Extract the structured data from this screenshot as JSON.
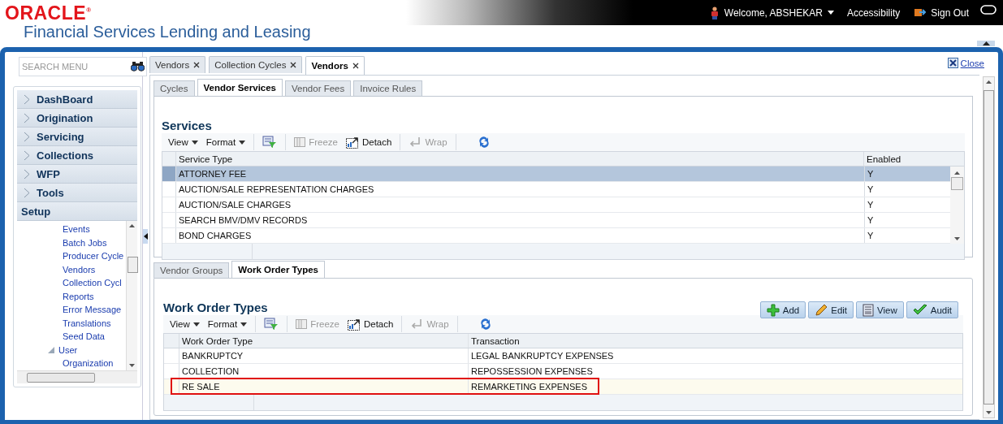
{
  "header": {
    "logo": "ORACLE$^{®}$",
    "product": "Financial Services Lending and Leasing",
    "welcome": "Welcome, ABSHEKAR",
    "accessibility": "Accessibility",
    "sign_out": "Sign Out"
  },
  "search": {
    "placeholder": "SEARCH MENU"
  },
  "nav": [
    {
      "label": "DashBoard",
      "expanded": false
    },
    {
      "label": "Origination",
      "expanded": false
    },
    {
      "label": "Servicing",
      "expanded": false
    },
    {
      "label": "Collections",
      "expanded": false
    },
    {
      "label": "WFP",
      "expanded": false
    },
    {
      "label": "Tools",
      "expanded": false
    },
    {
      "label": "Setup",
      "expanded": true
    }
  ],
  "setup_tree": [
    {
      "kind": "link",
      "label": "Events"
    },
    {
      "kind": "link",
      "label": "Batch Jobs"
    },
    {
      "kind": "link",
      "label": "Producer Cycle"
    },
    {
      "kind": "link",
      "label": "Vendors"
    },
    {
      "kind": "link",
      "label": "Collection Cycl"
    },
    {
      "kind": "link",
      "label": "Reports"
    },
    {
      "kind": "link",
      "label": "Error Message"
    },
    {
      "kind": "link",
      "label": "Translations"
    },
    {
      "kind": "link",
      "label": "Seed Data"
    },
    {
      "kind": "folder",
      "label": "User",
      "expanded": true,
      "children": [
        {
          "kind": "link",
          "label": "Organization"
        }
      ]
    }
  ],
  "page_tabs": [
    {
      "label": "Vendors",
      "selected": false
    },
    {
      "label": "Collection Cycles",
      "selected": false
    },
    {
      "label": "Vendors",
      "selected": true
    }
  ],
  "close": "Close",
  "sub_tabs": [
    {
      "label": "Cycles",
      "selected": false
    },
    {
      "label": "Vendor Services",
      "selected": true
    },
    {
      "label": "Vendor Fees",
      "selected": false
    },
    {
      "label": "Invoice Rules",
      "selected": false
    }
  ],
  "services": {
    "title": "Services",
    "toolbar": [
      {
        "kind": "menu",
        "label": "View"
      },
      {
        "kind": "menu",
        "label": "Format"
      },
      {
        "kind": "filter"
      },
      {
        "kind": "freeze",
        "label": "Freeze",
        "disabled": true
      },
      {
        "kind": "detach",
        "label": "Detach",
        "disabled": false
      },
      {
        "kind": "wrap",
        "label": "Wrap",
        "disabled": true
      },
      {
        "kind": "refresh"
      }
    ],
    "columns": [
      "Service Type",
      "Enabled"
    ],
    "rows": [
      {
        "cells": [
          "ATTORNEY FEE",
          "Y"
        ],
        "selected": true
      },
      {
        "cells": [
          "AUCTION/SALE REPRESENTATION CHARGES",
          "Y"
        ],
        "selected": false
      },
      {
        "cells": [
          "AUCTION/SALE CHARGES",
          "Y"
        ],
        "selected": false
      },
      {
        "cells": [
          "SEARCH BMV/DMV RECORDS",
          "Y"
        ],
        "selected": false
      },
      {
        "cells": [
          "BOND CHARGES",
          "Y"
        ],
        "selected": false
      }
    ]
  },
  "lower_tabs": [
    {
      "label": "Vendor Groups",
      "selected": false
    },
    {
      "label": "Work Order Types",
      "selected": true
    }
  ],
  "work_orders": {
    "title": "Work Order Types",
    "actions": [
      {
        "kind": "add",
        "label": "Add"
      },
      {
        "kind": "edit",
        "label": "Edit"
      },
      {
        "kind": "view",
        "label": "View"
      },
      {
        "kind": "audit",
        "label": "Audit"
      }
    ],
    "toolbar": [
      {
        "kind": "menu",
        "label": "View"
      },
      {
        "kind": "menu",
        "label": "Format"
      },
      {
        "kind": "filter"
      },
      {
        "kind": "freeze",
        "label": "Freeze",
        "disabled": true
      },
      {
        "kind": "detach",
        "label": "Detach",
        "disabled": false
      },
      {
        "kind": "wrap",
        "label": "Wrap",
        "disabled": true
      },
      {
        "kind": "refresh"
      }
    ],
    "columns": [
      "Work Order Type",
      "Transaction"
    ],
    "rows": [
      {
        "cells": [
          "BANKRUPTCY",
          "LEGAL BANKRUPTCY EXPENSES"
        ],
        "selected": false,
        "highlighted": false
      },
      {
        "cells": [
          "COLLECTION",
          "REPOSSESSION EXPENSES"
        ],
        "selected": false,
        "highlighted": false
      },
      {
        "cells": [
          "RE SALE",
          "REMARKETING EXPENSES"
        ],
        "selected": true,
        "highlighted": true
      }
    ]
  }
}
